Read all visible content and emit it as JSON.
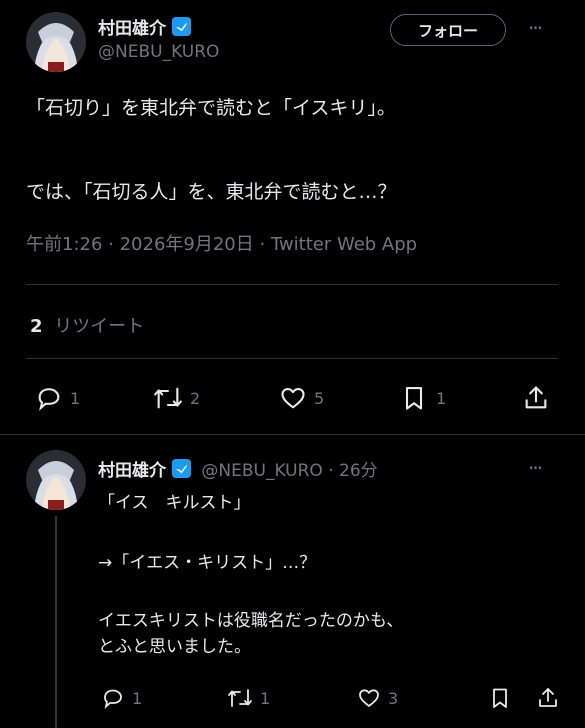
{
  "main_tweet": {
    "author_name": "村田雄介",
    "handle": "@NEBU_KURO",
    "follow_label": "フォロー",
    "more_label": "···",
    "lines": [
      "「石切り」を東北弁で読むと「イスキリ」。",
      "",
      "では、「石切る人」を、東北弁で読むと…？"
    ],
    "meta": "午前1:26 · 2026年9月20日 · Twitter Web App",
    "retweet_count": "2",
    "retweet_label": "リツイート",
    "actions": {
      "reply": "1",
      "retweet": "2",
      "like": "5",
      "bookmark": "1"
    }
  },
  "reply_tweet": {
    "author_name": "村田雄介",
    "handle_time": "@NEBU_KURO · 26分",
    "more_label": "···",
    "lines": [
      "「イス　キルスト」",
      "",
      "→「イエス・キリスト」…？",
      "",
      "イエスキリストは役職名だったのかも、",
      "とふと思いました。"
    ],
    "actions": {
      "reply": "1",
      "retweet": "1",
      "like": "3"
    }
  },
  "colors": {
    "verified": "#1d9bf0",
    "text": "#e7e9ea",
    "muted": "#71767b",
    "divider": "#2f3336"
  }
}
